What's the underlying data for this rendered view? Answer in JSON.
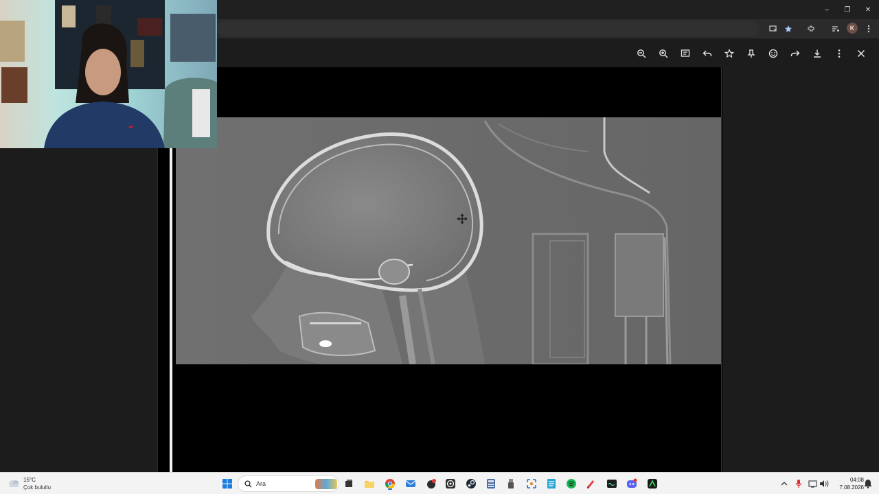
{
  "browser": {
    "window_buttons": {
      "minimize": "–",
      "restore": "❐",
      "close": "✕"
    },
    "addressbar_icons": [
      "install-icon",
      "bookmark-star-icon",
      "extensions-icon",
      "media-icon"
    ],
    "profile_initial": "K"
  },
  "viewer": {
    "toolbar": [
      "zoom-out-icon",
      "zoom-in-icon",
      "caption-icon",
      "reply-icon",
      "star-icon",
      "pin-icon",
      "emoji-icon",
      "forward-icon",
      "download-icon",
      "more-icon",
      "close-icon"
    ],
    "image": "lateral skull x-ray"
  },
  "taskbar": {
    "weather": {
      "temp": "15°C",
      "desc": "Çok bulutlu"
    },
    "search": {
      "label": "Ara"
    },
    "apps": [
      "windows-start",
      "search",
      "task-view",
      "file-explorer",
      "chrome",
      "mail",
      "app-red",
      "obs",
      "steam",
      "calculator",
      "app-usb",
      "snipping",
      "notepad",
      "spotify",
      "app-red-pen",
      "terminal",
      "discord",
      "app-green"
    ],
    "tray": [
      "chevron-up-icon",
      "microphone-icon",
      "network-icon",
      "speaker-icon"
    ],
    "clock": {
      "time": "04:08",
      "date": "7.08.2026"
    }
  },
  "colors": {
    "accent": "#1a73e8",
    "taskbar_bg": "#f3f3f3",
    "viewer_bg": "#1c1c1c"
  }
}
